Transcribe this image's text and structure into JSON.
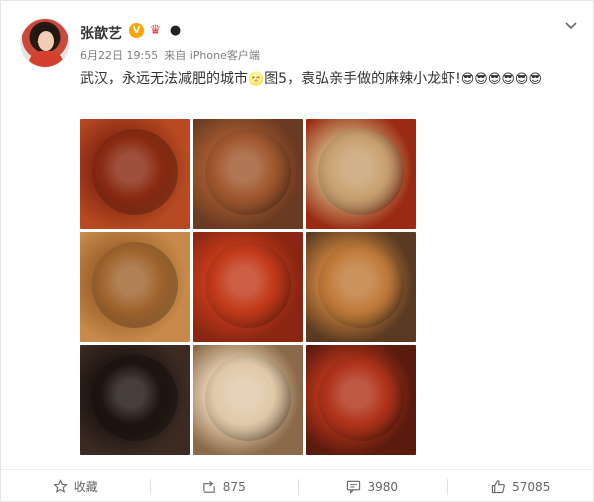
{
  "user": {
    "name": "张歆艺",
    "vip_badge": "V"
  },
  "meta": {
    "date": "6月22日 19:55",
    "source": "来自 iPhone客户端"
  },
  "post": {
    "text_part1": "武汉，永远无法减肥的城市",
    "text_part2": "图5，袁弘亲手做的麻辣小龙虾!",
    "emoji_moon": "🌝",
    "emoji_cool": "😎😎😎😎😎😎"
  },
  "photos": [
    {
      "label": "photo-1",
      "bg": "#b64a22",
      "plate": "#8a2a12"
    },
    {
      "label": "photo-2",
      "bg": "#6b3a22",
      "plate": "#a0582e"
    },
    {
      "label": "photo-3",
      "bg": "#9a2a12",
      "plate": "#c8a070"
    },
    {
      "label": "photo-4",
      "bg": "#c78a4a",
      "plate": "#a0642e"
    },
    {
      "label": "photo-5",
      "bg": "#8a2612",
      "plate": "#c23a1a"
    },
    {
      "label": "photo-6",
      "bg": "#5a3a22",
      "plate": "#c07a3a"
    },
    {
      "label": "photo-7",
      "bg": "#3a2a22",
      "plate": "#1e1410"
    },
    {
      "label": "photo-8",
      "bg": "#8a6a4a",
      "plate": "#e0c8a8"
    },
    {
      "label": "photo-9",
      "bg": "#5a1a0e",
      "plate": "#b0331a"
    }
  ],
  "actions": {
    "favorite": "收藏",
    "repost": "875",
    "comment": "3980",
    "like": "57085"
  },
  "colors": {
    "accent_orange": "#f7a300",
    "text_main": "#333333",
    "text_meta": "#808080"
  }
}
